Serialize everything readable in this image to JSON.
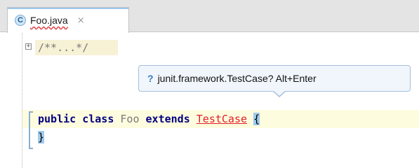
{
  "tab": {
    "icon_letter": "C",
    "title": "Foo.java",
    "close_glyph": "×"
  },
  "editor": {
    "folded_comment": "/**...*/",
    "fold_glyph": "+",
    "tooltip": {
      "icon": "?",
      "text": "junit.framework.TestCase? Alt+Enter"
    },
    "code": {
      "kw_public": "public",
      "kw_class": "class",
      "class_name": "Foo",
      "kw_extends": "extends",
      "super_class": "TestCase",
      "open_brace": "{",
      "close_brace": "}",
      "space": " "
    }
  }
}
